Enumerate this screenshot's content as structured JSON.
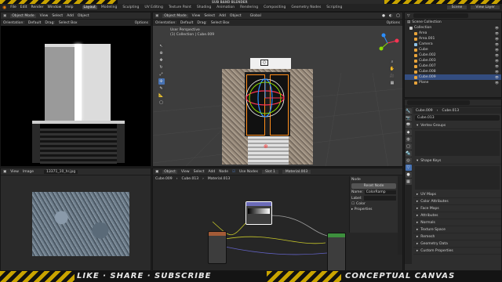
{
  "top_banner": {
    "text": "SUB BAND BLENDER"
  },
  "menubar": {
    "items": [
      "File",
      "Edit",
      "Render",
      "Window",
      "Help"
    ],
    "workspaces": [
      "Layout",
      "Modeling",
      "Sculpting",
      "UV Editing",
      "Texture Paint",
      "Shading",
      "Animation",
      "Rendering",
      "Compositing",
      "Geometry Nodes",
      "Scripting"
    ],
    "active_workspace": "Layout",
    "scene": "Scene",
    "view_layer": "View Layer"
  },
  "left_viewport": {
    "header": [
      "Object Mode",
      "View",
      "Select",
      "Add",
      "Object"
    ],
    "subheader": [
      "Orientation:",
      "Default",
      "Drag:",
      "Select Box",
      "Options"
    ]
  },
  "main_viewport": {
    "header": [
      "Object Mode",
      "View",
      "Select",
      "Add",
      "Object",
      "Global"
    ],
    "subheader": [
      "Orientation:",
      "Default",
      "Drag:",
      "Select Box",
      "Options"
    ],
    "overlay_line1": "User Perspective",
    "overlay_line2": "(1) Collection | Cube.009"
  },
  "outliner": {
    "header": "Scene Collection",
    "rows": [
      {
        "label": "Collection",
        "color": "#cccccc",
        "selected": false
      },
      {
        "label": "Area",
        "color": "#e8a33a",
        "selected": false
      },
      {
        "label": "Area.001",
        "color": "#e8a33a",
        "selected": false
      },
      {
        "label": "Camera",
        "color": "#8ec2e8",
        "selected": false
      },
      {
        "label": "Cube",
        "color": "#e8a33a",
        "selected": false
      },
      {
        "label": "Cube.002",
        "color": "#e8a33a",
        "selected": false
      },
      {
        "label": "Cube.003",
        "color": "#e8a33a",
        "selected": false
      },
      {
        "label": "Cube.007",
        "color": "#e8a33a",
        "selected": false
      },
      {
        "label": "Cube.008",
        "color": "#e8a33a",
        "selected": false
      },
      {
        "label": "Cube.009",
        "color": "#e8a33a",
        "selected": true
      },
      {
        "label": "Plane",
        "color": "#e8a33a",
        "selected": false
      }
    ]
  },
  "properties": {
    "crumb_a": "Cube.009",
    "crumb_b": "Cube.013",
    "object_name": "Cube.013",
    "sections": [
      "Vertex Groups",
      "Shape Keys",
      "UV Maps",
      "Color Attributes",
      "Face Maps",
      "Attributes",
      "Normals",
      "Texture Space",
      "Remesh",
      "Geometry Data",
      "Custom Properties"
    ]
  },
  "image_editor": {
    "header": [
      "View",
      "Image"
    ],
    "image_name": "13371_10_hr.jpg"
  },
  "node_editor": {
    "header": [
      "Object",
      "View",
      "Select",
      "Add",
      "Node",
      "Use Nodes",
      "Slot 1",
      "Material.003"
    ],
    "breadcrumb": [
      "Cube.009",
      "Cube.013",
      "Material.013"
    ],
    "sidebar_title": "Node",
    "reset_label": "Reset Node",
    "name_label": "Name:",
    "name_value": "ColorRamp",
    "label_label": "Label:",
    "color_label": "Color",
    "properties_label": "Properties"
  },
  "bottom_banner": {
    "left_text": "LIKE · SHARE · SUBSCRIBE",
    "right_text": "CONCEPTUAL CANVAS"
  },
  "colors": {
    "accent": "#4772b3",
    "select_orange": "#ff8c1a",
    "hazard_yellow": "#c9a400"
  }
}
